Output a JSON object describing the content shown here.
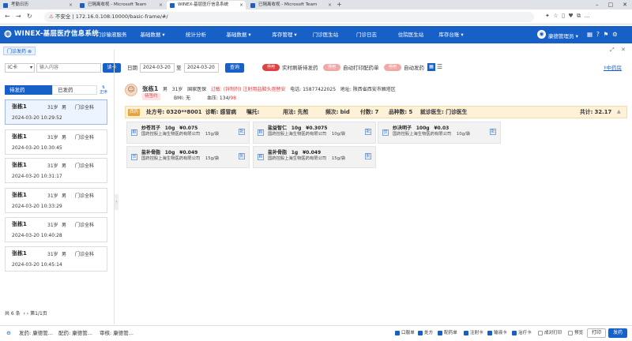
{
  "browser": {
    "tabs": [
      {
        "label": "考勤日历"
      },
      {
        "label": "已隔离收视 - Microsoft Team"
      },
      {
        "label": "WINEX-基层医疗信息系统"
      },
      {
        "label": "已隔离收视 - Microsoft Team"
      }
    ],
    "url_security": "不安全",
    "url": "172.16.0.108:10000/basic-frame/#/"
  },
  "app": {
    "title": "WINEX-基层医疗信息系统",
    "menu": [
      "门诊输液服务",
      "基础数据",
      "统计分析",
      "基础数据",
      "库存管理",
      "门诊医生站",
      "门诊日志",
      "住院医生站",
      "库存台账"
    ],
    "user": "康德管理员"
  },
  "page_tab": {
    "label": "门诊发药"
  },
  "toolbar": {
    "card_type": "IC卡",
    "card_placeholder": "输入内容",
    "read_card": "读卡",
    "date_label": "日期",
    "date_from": "2024-03-20",
    "date_sep": "至",
    "date_to": "2024-03-20",
    "query": "查询",
    "toggle_off_text": "停用",
    "auto_refresh": "实时刷新待发药",
    "auto_print": "自动打印配药单",
    "auto_dispense": "自动发药",
    "right_link": "中药房"
  },
  "list": {
    "tab_pending": "待发药",
    "tab_done": "已发药",
    "patients": [
      {
        "name": "张栋1",
        "age": "31岁",
        "sex": "男",
        "dept": "门诊全科",
        "time": "2024-03-20 10:29:52"
      },
      {
        "name": "张栋1",
        "age": "31岁",
        "sex": "男",
        "dept": "门诊全科",
        "time": "2024-03-20 10:30:45"
      },
      {
        "name": "张栋1",
        "age": "31岁",
        "sex": "男",
        "dept": "门诊全科",
        "time": "2024-03-20 10:31:17"
      },
      {
        "name": "张栋1",
        "age": "31岁",
        "sex": "男",
        "dept": "门诊全科",
        "time": "2024-03-20 10:33:29"
      },
      {
        "name": "张栋1",
        "age": "31岁",
        "sex": "男",
        "dept": "门诊全科",
        "time": "2024-03-20 10:40:28"
      },
      {
        "name": "张栋1",
        "age": "31岁",
        "sex": "男",
        "dept": "门诊全科",
        "time": "2024-03-20 10:45:14"
      }
    ],
    "total": "共 6 条",
    "page": "第1/1页"
  },
  "patient": {
    "name": "张栋1",
    "sex": "男",
    "age": "31岁",
    "insurance": "国家医保",
    "allergy_label": "过敏:",
    "allergy": "(锌制剂) 注射用盐酸头孢替安",
    "phone_label": "电话:",
    "phone": "15877422025",
    "address_label": "地址:",
    "address": "陕西省西安市雁塔区",
    "status": "待签约",
    "bmi": "BMI: 无",
    "bp_label": "血压: 134/",
    "bp_low": "98"
  },
  "prescription": {
    "tag": "西药",
    "rx_no": "处方号: 0320**8001",
    "diagnosis": "诊断: 感冒病",
    "entrust": "嘱托:",
    "usage": "用法: 先煎",
    "freq": "频次: bid",
    "doses": "付数: 7",
    "kinds": "品种数: 5",
    "doctor": "就诊医生: 门诊医生",
    "total": "共计: 32.17",
    "meds": [
      {
        "icon": "颗",
        "name": "炒苍耳子",
        "qty": "10g",
        "price": "¥0.075",
        "maker": "国药控股上海生物医药有限公司",
        "spec": "15g/袋",
        "btn": "批"
      },
      {
        "icon": "颗",
        "name": "盐益智仁",
        "qty": "10g",
        "price": "¥0.3075",
        "maker": "国药控股上海生物医药有限公司",
        "spec": "10g/袋",
        "btn": "批"
      },
      {
        "icon": "饮",
        "name": "炒决明子",
        "qty": "100g",
        "price": "¥0.03",
        "maker": "国药控股上海生物医药有限公司",
        "spec": "10g/袋",
        "btn": "批"
      },
      {
        "icon": "饮",
        "name": "盐补骨脂",
        "qty": "10g",
        "price": "¥0.049",
        "maker": "国药控股上海生物医药有限公司",
        "spec": "15g/袋",
        "btn": "批"
      },
      {
        "icon": "颗",
        "name": "盐补骨脂",
        "qty": "1g",
        "price": "¥0.049",
        "maker": "国药控股上海生物医药有限公司",
        "spec": "15g/袋",
        "btn": "批"
      }
    ]
  },
  "footer": {
    "dispenser": "发药: 康德管...",
    "preparer": "配药: 康德管...",
    "checker": "审核: 康德管...",
    "options": [
      "口服单",
      "处方",
      "配药单",
      "注射卡",
      "输液卡",
      "治疗卡",
      "成对打印",
      "预览"
    ],
    "print": "打印",
    "dispense": "发药"
  },
  "colors": {
    "brand": "#1760c8",
    "alert": "#e04040"
  }
}
